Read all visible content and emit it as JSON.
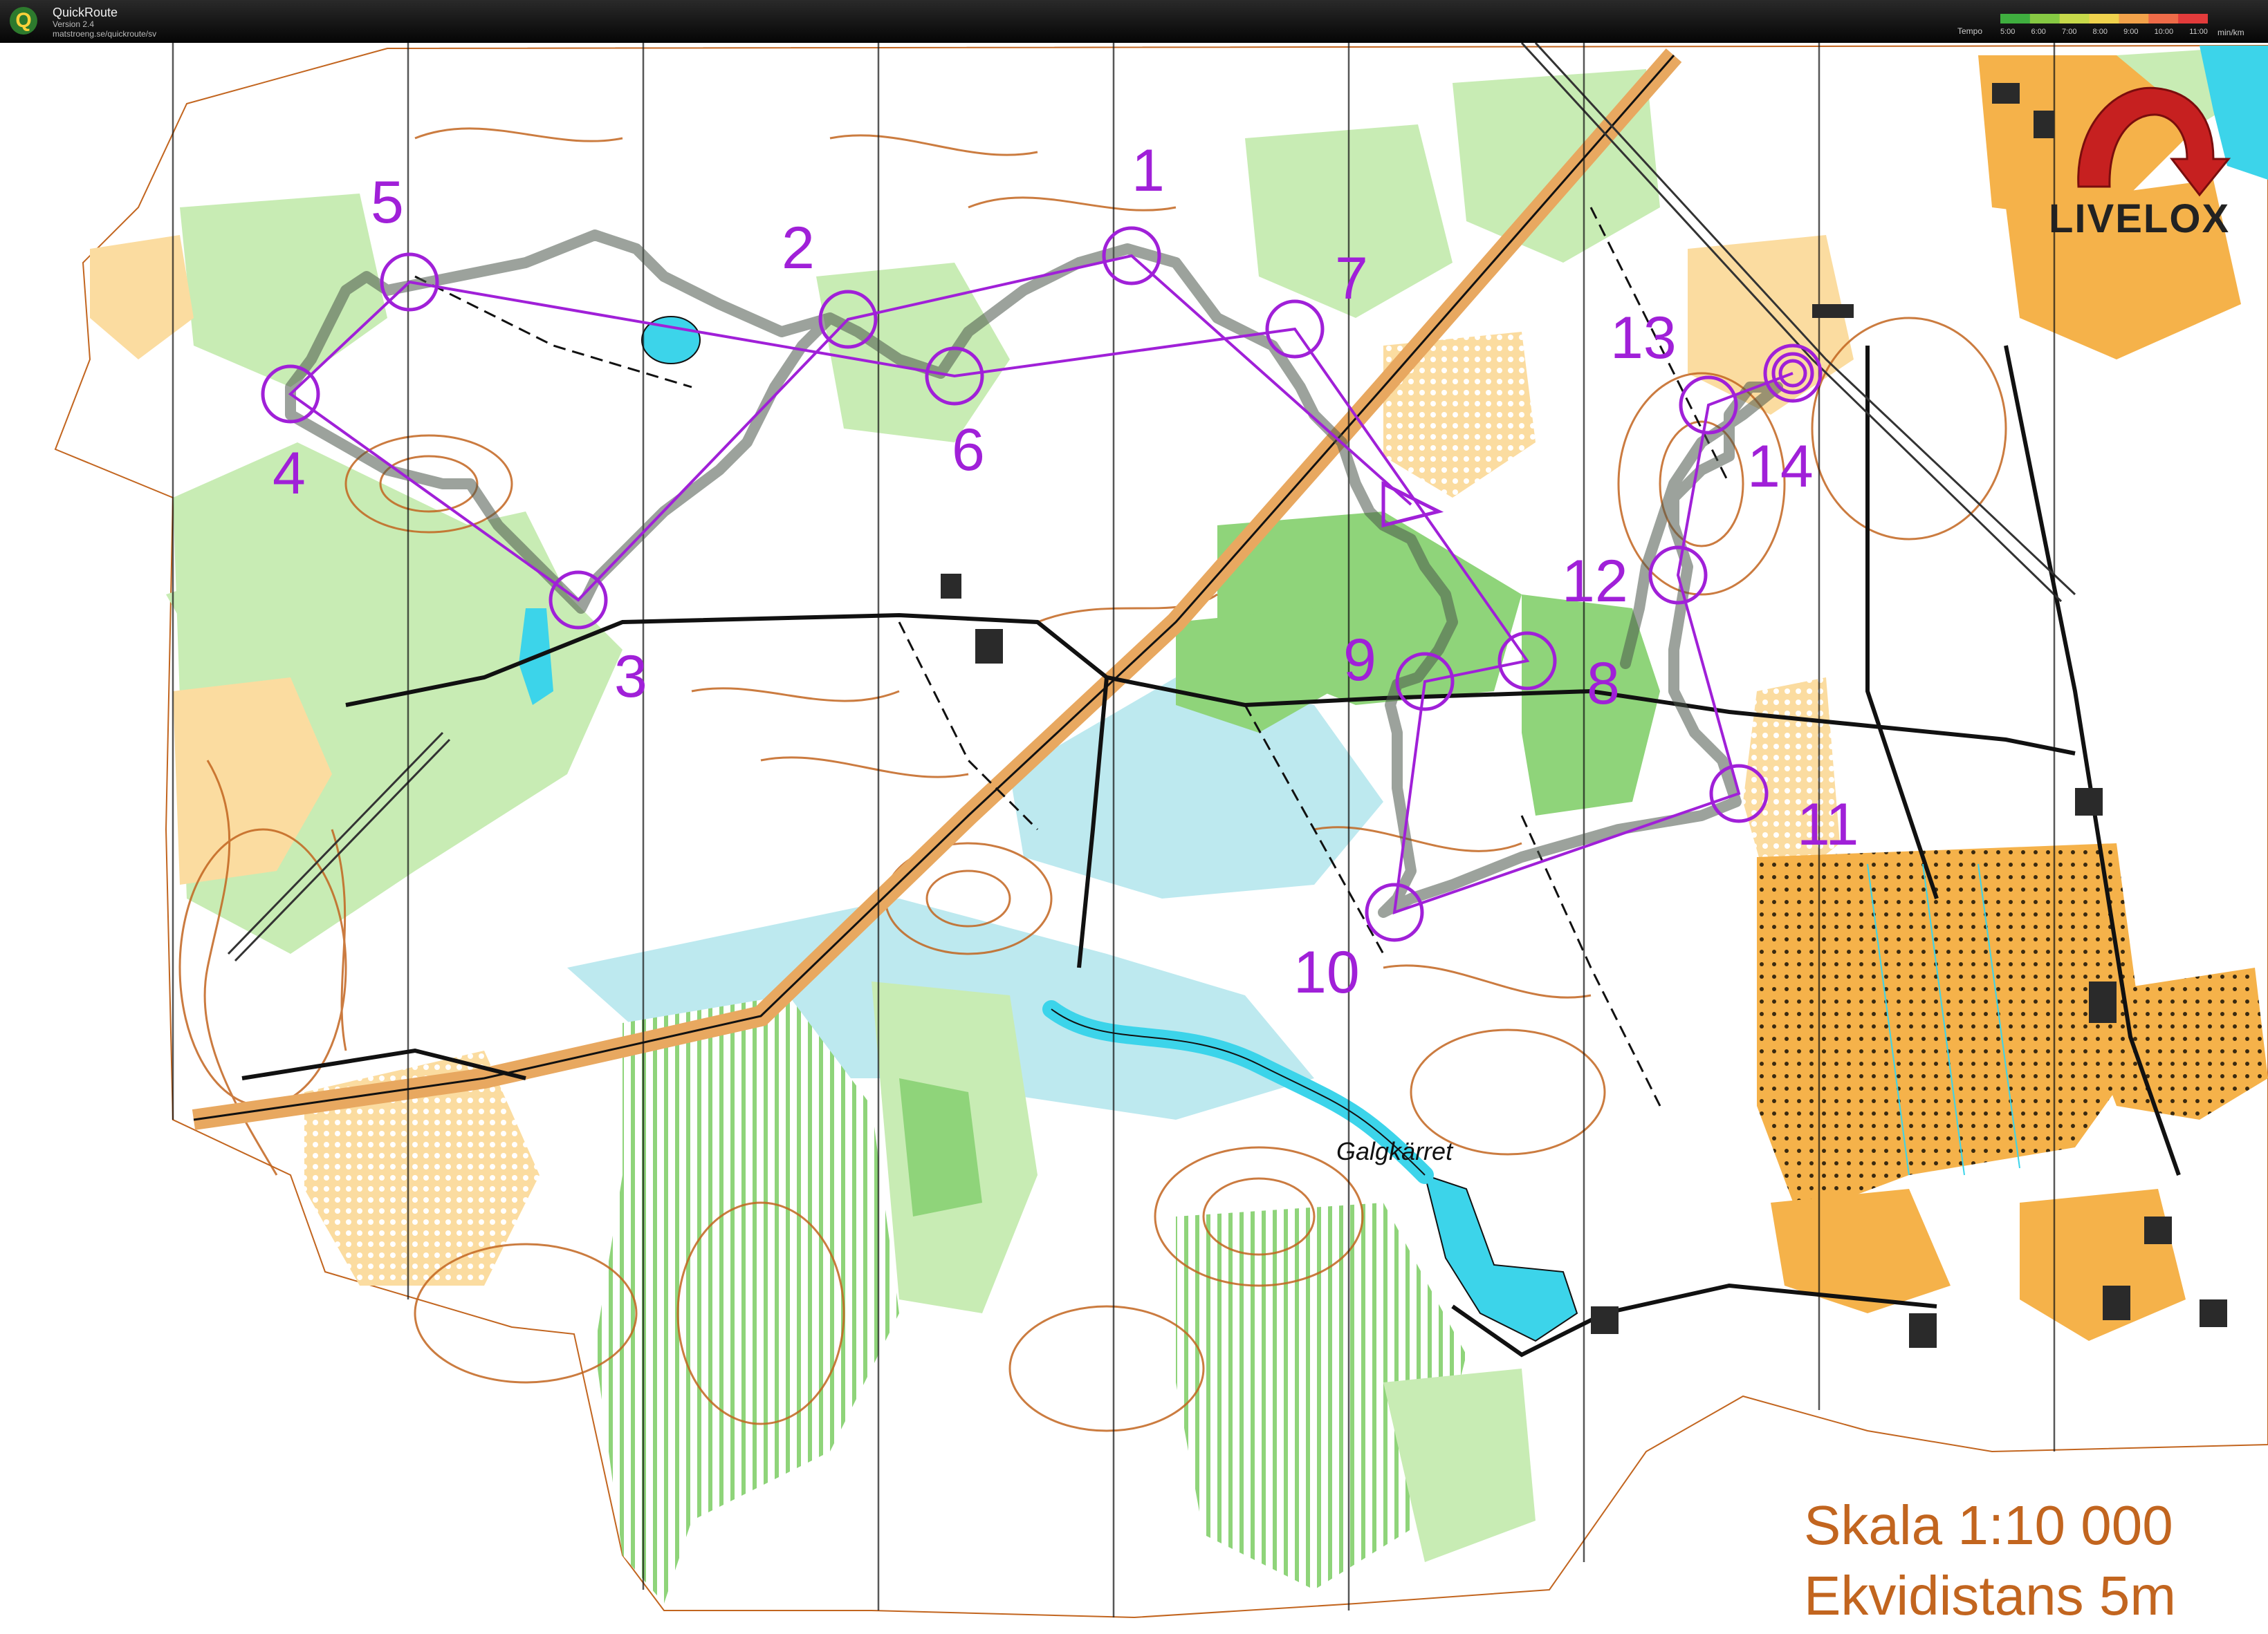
{
  "app": {
    "title": "QuickRoute",
    "version": "Version 2.4",
    "url": "matstroeng.se/quickroute/sv"
  },
  "tempo_legend": {
    "label": "Tempo",
    "ticks": [
      "5:00",
      "6:00",
      "7:00",
      "8:00",
      "9:00",
      "10:00",
      "11:00"
    ],
    "unit": "min/km",
    "colors": [
      "#3fae3f",
      "#86c943",
      "#c7d94a",
      "#f0d24d",
      "#f2a24a",
      "#ee6b48",
      "#e23b3b"
    ]
  },
  "brand": {
    "text": "LIVELOX"
  },
  "controls": [
    {
      "number": "1"
    },
    {
      "number": "2"
    },
    {
      "number": "3"
    },
    {
      "number": "4"
    },
    {
      "number": "5"
    },
    {
      "number": "6"
    },
    {
      "number": "7"
    },
    {
      "number": "8"
    },
    {
      "number": "9"
    },
    {
      "number": "10"
    },
    {
      "number": "11"
    },
    {
      "number": "12"
    },
    {
      "number": "13"
    },
    {
      "number": "14"
    }
  ],
  "place_names": [
    "Galgkärret"
  ],
  "scale": {
    "line1": "Skala 1:10 000",
    "line2": "Ekvidistans 5m"
  },
  "colors": {
    "course": "#a020d8",
    "route": "#5f6b5f",
    "forest_green": "#8fd47a",
    "light_green": "#c8ecb4",
    "open_yellow": "#f5b24a",
    "rough_yellow": "#fbdca0",
    "marsh_blue": "#bde9ef",
    "water": "#3cd4ea",
    "contour_brown": "#c2651f",
    "scale_text": "#c2651f"
  }
}
